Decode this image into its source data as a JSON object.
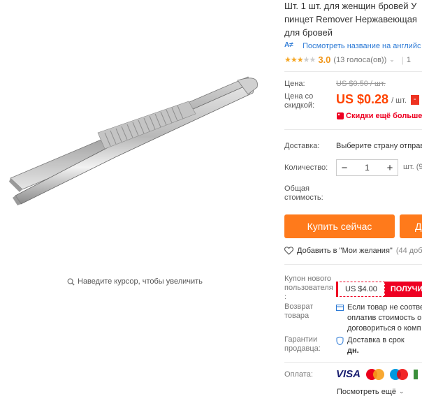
{
  "gallery": {
    "zoom_hint": "Наведите курсор, чтобы увеличить"
  },
  "product": {
    "title_lines": [
      "Шт. 1 шт. для женщин бровей У",
      "пинцет Remover Нержавеющая",
      "для бровей"
    ],
    "translate_link": "Посмотреть название на английс",
    "translate_icon_text": "A≠",
    "rating": "3.0",
    "votes": "(13 голоса(ов))",
    "orders_fragment": "1",
    "stars_filled": 3
  },
  "pricing": {
    "price_label": "Цена:",
    "old_price": "US $0.50 / шт.",
    "discount_label_1": "Цена со",
    "discount_label_2": "скидкой:",
    "price": "US $0.28",
    "unit": "/ шт.",
    "badge": "-",
    "promo": "Скидки ещё больше в",
    "accent": "#ff4400"
  },
  "delivery": {
    "label": "Доставка:",
    "value": "Выберите страну отправ"
  },
  "quantity": {
    "label": "Количество:",
    "value": "1",
    "minus": "−",
    "plus": "+",
    "unit": "шт. (9"
  },
  "total": {
    "label_1": "Общая",
    "label_2": "стоимость:"
  },
  "actions": {
    "buy_now": "Купить сейчас",
    "add_to_cart": "Д",
    "wishlist": "Добавить в \"Мои желания\"",
    "wishlist_count": "(44 доба"
  },
  "coupon": {
    "label_1": "Купон нового",
    "label_2": "пользователя",
    "label_3": ":",
    "amount": "US $4.00",
    "get": "ПОЛУЧИ"
  },
  "returns": {
    "label_1": "Возврат",
    "label_2": "товара",
    "lines": [
      "Если товар не соотве",
      "оплатив стоимость о",
      "договориться о комп"
    ]
  },
  "guarantee": {
    "label_1": "Гарантии",
    "label_2": "продавца:",
    "line_1": "Доставка в срок",
    "line_2": "дн."
  },
  "payment": {
    "label": "Оплата:",
    "visa": "VISA",
    "see_all": "Посмотреть ещё"
  }
}
